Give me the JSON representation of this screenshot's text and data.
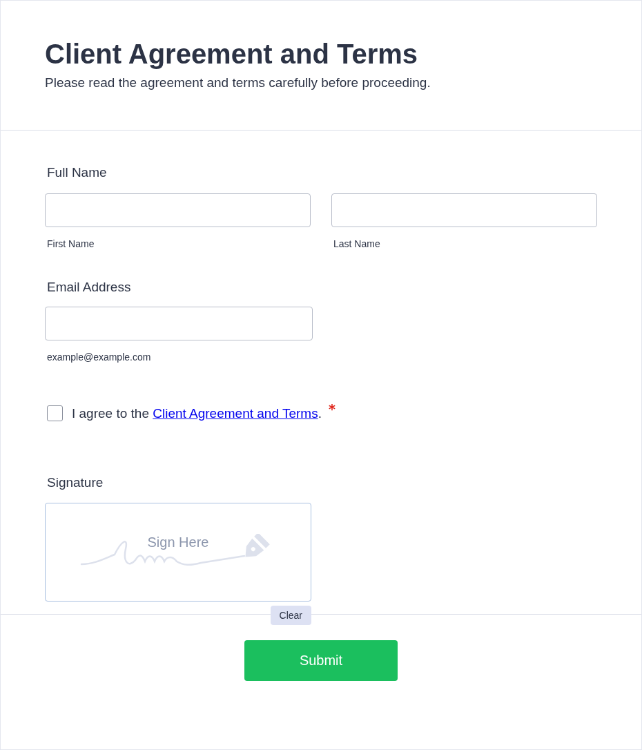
{
  "header": {
    "title": "Client Agreement and Terms",
    "subtitle": "Please read the agreement and terms carefully before proceeding."
  },
  "full_name": {
    "label": "Full Name",
    "fields": [
      {
        "sublabel": "First Name"
      },
      {
        "sublabel": "Last Name"
      }
    ]
  },
  "email": {
    "label": "Email Address",
    "sublabel": "example@example.com"
  },
  "agreement": {
    "checked": false,
    "prefix": "I agree to the ",
    "link": "Client Agreement and Terms",
    "suffix": ".",
    "required": true,
    "required_mark": "*"
  },
  "signature": {
    "label": "Signature",
    "placeholder": "Sign Here",
    "clear_button": "Clear"
  },
  "submit_button": "Submit"
}
